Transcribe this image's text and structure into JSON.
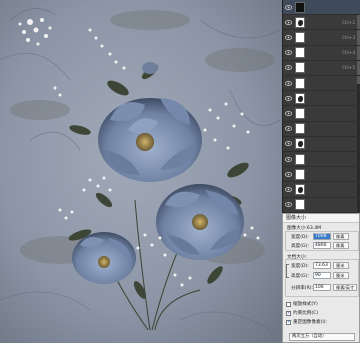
{
  "layers": {
    "rows": [
      {
        "name": "",
        "shortcut": "",
        "thumb": "dark",
        "active": true
      },
      {
        "name": "",
        "shortcut": "Ctrl+2",
        "thumb": "blob",
        "active": false
      },
      {
        "name": "",
        "shortcut": "Ctrl+3",
        "thumb": "white",
        "active": false
      },
      {
        "name": "",
        "shortcut": "Ctrl+4",
        "thumb": "white",
        "active": false
      },
      {
        "name": "",
        "shortcut": "Ctrl+5",
        "thumb": "white",
        "active": false
      },
      {
        "name": "",
        "shortcut": "",
        "thumb": "white",
        "active": false
      },
      {
        "name": "",
        "shortcut": "",
        "thumb": "blob",
        "active": false
      },
      {
        "name": "",
        "shortcut": "",
        "thumb": "white",
        "active": false
      },
      {
        "name": "",
        "shortcut": "",
        "thumb": "white",
        "active": false
      },
      {
        "name": "",
        "shortcut": "",
        "thumb": "blob",
        "active": false
      },
      {
        "name": "",
        "shortcut": "",
        "thumb": "white",
        "active": false
      },
      {
        "name": "",
        "shortcut": "",
        "thumb": "white",
        "active": false
      },
      {
        "name": "",
        "shortcut": "",
        "thumb": "blob",
        "active": false
      },
      {
        "name": "",
        "shortcut": "",
        "thumb": "white",
        "active": false
      }
    ]
  },
  "dialog": {
    "title": "图像大小",
    "image_size": "图像大小:63.4M",
    "width_label": "宽度(D):",
    "width_value": "7008",
    "width_unit": "像素",
    "height_label": "高度(G):",
    "height_value": "4800",
    "height_unit": "像素",
    "doc_label": "文档大小:",
    "doc_width_label": "宽度(D):",
    "doc_width_value": "73.63",
    "doc_width_unit": "厘米",
    "doc_height_label": "高度(G):",
    "doc_height_value": "90",
    "doc_height_unit": "厘米",
    "resolution_label": "分辨率(R):",
    "resolution_value": "100",
    "resolution_unit": "像素/英寸",
    "scale_styles": "缩放样式(Y)",
    "constrain": "约束比例(C)",
    "resample": "重定图像像素(I):",
    "resample_method": "两次立方（自动）"
  }
}
